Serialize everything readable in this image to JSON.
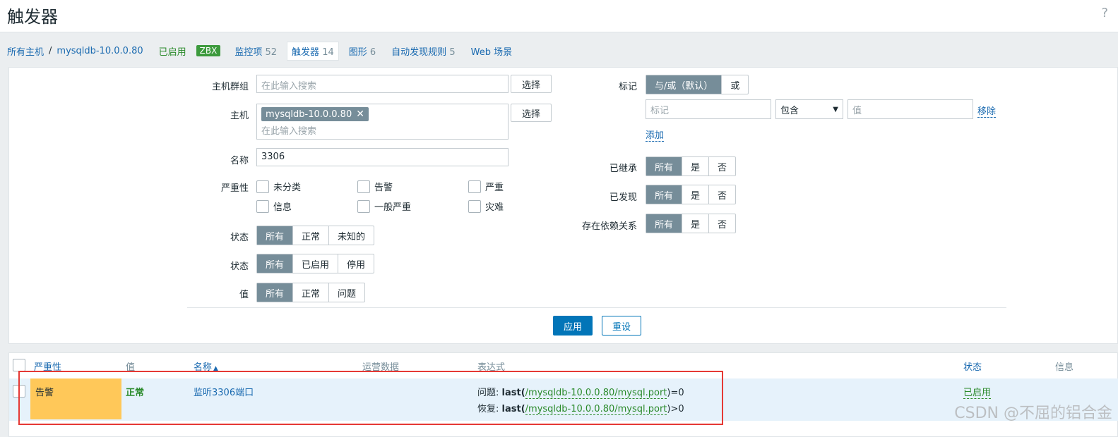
{
  "page": {
    "title": "触发器",
    "help": "?"
  },
  "breadcrumb": {
    "all_hosts": "所有主机",
    "separator": "/",
    "host": "mysqldb-10.0.0.80",
    "status": "已启用",
    "badge": "ZBX",
    "items_label": "监控项",
    "items_count": "52",
    "triggers_label": "触发器",
    "triggers_count": "14",
    "graphs_label": "图形",
    "graphs_count": "6",
    "discovery_label": "自动发现规则",
    "discovery_count": "5",
    "web_label": "Web 场景"
  },
  "filter": {
    "host_group_label": "主机群组",
    "host_group_placeholder": "在此输入搜索",
    "select_label": "选择",
    "host_label": "主机",
    "host_chip": "mysqldb-10.0.0.80",
    "host_placeholder": "在此输入搜索",
    "name_label": "名称",
    "name_value": "3306",
    "severity_label": "严重性",
    "severities": [
      "未分类",
      "告警",
      "严重",
      "信息",
      "一般严重",
      "灾难"
    ],
    "state_label": "状态",
    "state_options": [
      "所有",
      "正常",
      "未知的"
    ],
    "status_label": "状态",
    "status_options": [
      "所有",
      "已启用",
      "停用"
    ],
    "value_label": "值",
    "value_options": [
      "所有",
      "正常",
      "问题"
    ],
    "tags_label": "标记",
    "tags_op_options": [
      "与/或（默认）",
      "或"
    ],
    "tag_placeholder": "标记",
    "tag_operator": "包含",
    "tag_value_placeholder": "值",
    "remove_label": "移除",
    "add_label": "添加",
    "inherited_label": "已继承",
    "discovered_label": "已发现",
    "dependencies_label": "存在依赖关系",
    "yes_no_options": [
      "所有",
      "是",
      "否"
    ],
    "apply_label": "应用",
    "reset_label": "重设"
  },
  "table": {
    "headers": {
      "severity": "严重性",
      "value": "值",
      "name": "名称",
      "sort_arrow": "▲",
      "operational_data": "运营数据",
      "expression": "表达式",
      "status": "状态",
      "info": "信息"
    },
    "rows": [
      {
        "severity": "告警",
        "value": "正常",
        "name": "监听3306端口",
        "problem_prefix": "问题:",
        "problem_func": "last(",
        "problem_item": "/mysqldb-10.0.0.80/mysql.port",
        "problem_suffix": ")=0",
        "recovery_prefix": "恢复:",
        "recovery_func": "last(",
        "recovery_item": "/mysqldb-10.0.0.80/mysql.port",
        "recovery_suffix": ")>0",
        "status": "已启用"
      }
    ]
  },
  "watermark": "CSDN @不屈的铝合金",
  "colors": {
    "accent": "#0275b8",
    "warning": "#ffc859",
    "ok_green": "#2a8a2a",
    "highlight_box": "#e53935"
  }
}
